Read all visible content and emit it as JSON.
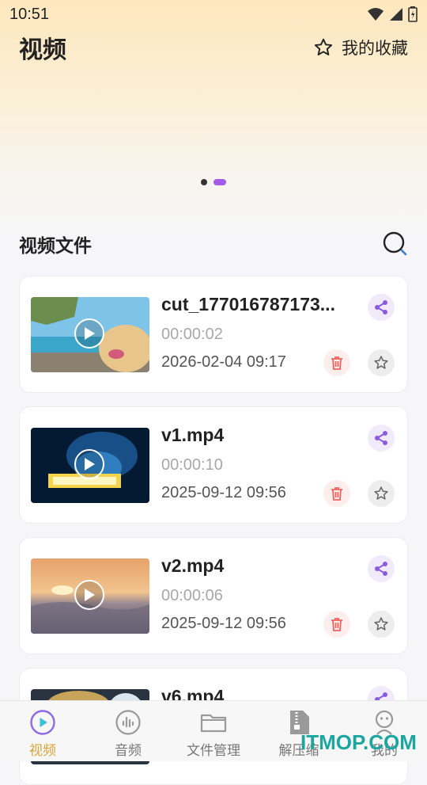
{
  "status_bar": {
    "time": "10:51",
    "icons": [
      "wifi-icon",
      "signal-icon",
      "battery-icon"
    ]
  },
  "header": {
    "title": "视频",
    "favorites_label": "我的收藏"
  },
  "banner": {
    "page_count": 2,
    "active_page": 2
  },
  "section": {
    "title": "视频文件"
  },
  "videos": [
    {
      "name": "cut_177016787173...",
      "duration": "00:00:02",
      "date": "2026-02-04 09:17"
    },
    {
      "name": "v1.mp4",
      "duration": "00:00:10",
      "date": "2025-09-12 09:56"
    },
    {
      "name": "v2.mp4",
      "duration": "00:00:06",
      "date": "2025-09-12 09:56"
    },
    {
      "name": "v6.mp4",
      "duration": "",
      "date": ""
    }
  ],
  "bottom_nav": [
    {
      "label": "视频",
      "icon": "play-circle-icon",
      "active": true
    },
    {
      "label": "音频",
      "icon": "audio-bars-icon",
      "active": false
    },
    {
      "label": "文件管理",
      "icon": "folder-icon",
      "active": false
    },
    {
      "label": "解压缩",
      "icon": "zip-file-icon",
      "active": false
    },
    {
      "label": "我的",
      "icon": "profile-icon",
      "active": false
    }
  ],
  "watermark": "ITMOP.COM",
  "colors": {
    "accent": "#a45be8",
    "active_tab": "#d9a53a",
    "delete": "#f0625e",
    "watermark": "#1aa7a0"
  }
}
